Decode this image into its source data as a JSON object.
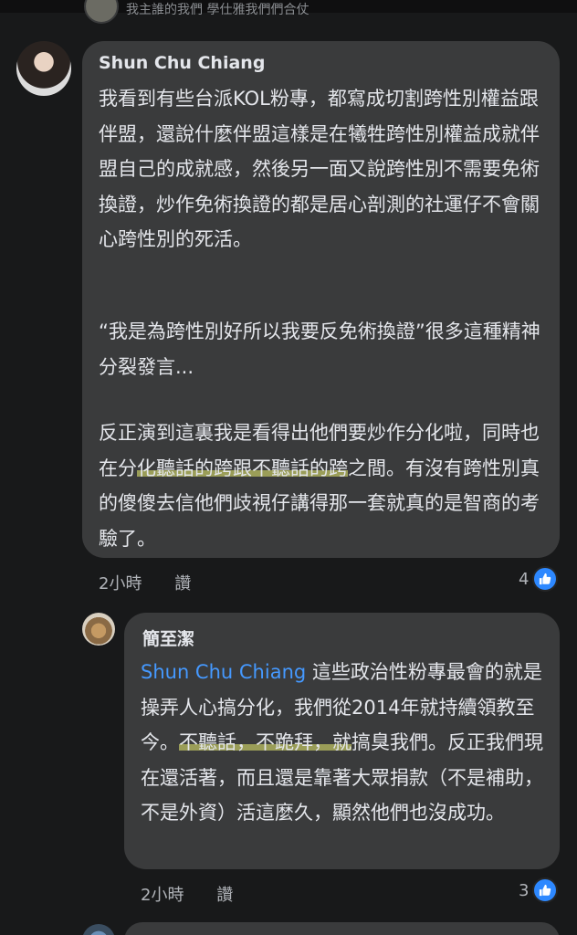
{
  "previous_reply": {
    "text": "我主誰的我們 學仕雅我們們合仗"
  },
  "comment": {
    "author": "Shun Chu Chiang",
    "paragraphs": [
      "我看到有些台派KOL粉專，都寫成切割跨性別權益跟伴盟，還說什麼伴盟這樣是在犧牲跨性別權益成就伴盟自己的成就感，然後另一面又說跨性別不需要免術換證，炒作免術換證的都是居心剖測的社運仔不會關心跨性別的死活。",
      "“我是為跨性別好所以我要反免術換證”很多這種精神分裂發言..."
    ],
    "paragraph3_before": "反正演到這裏我是看得出他們要炒作分化啦，同時也在分",
    "paragraph3_highlight": "化聽話的跨跟不聽話的跨",
    "paragraph3_after": "之間。有沒有跨性別真的傻傻去信他們歧視仔講得那一套就真的是智商的考驗了。",
    "time": "2小時",
    "like_label": "讚",
    "reaction_count": "4"
  },
  "reply": {
    "author": "簡至潔",
    "mention": "Shun Chu Chiang",
    "text_before": " 這些政治性粉專最會的就是操弄人心搞分化，我們從2014年就持續領教至今。",
    "text_highlight": "不聽話，不跪拜，就",
    "text_after": "搞臭我們。反正我們現在還活著，而且還是靠著大眾捐款（不是補助，不是外資）活這麼久，顯然他們也沒成功。",
    "time": "2小時",
    "like_label": "讚",
    "reaction_count": "3"
  },
  "colors": {
    "background": "#18191a",
    "bubble": "#3a3b3c",
    "text": "#e4e6eb",
    "secondary_text": "#b0b3b8",
    "mention": "#4599ff",
    "like_blue": "#2d88ff",
    "highlight": "#e8ee6e"
  },
  "icons": {
    "like": "thumbs-up-icon"
  }
}
